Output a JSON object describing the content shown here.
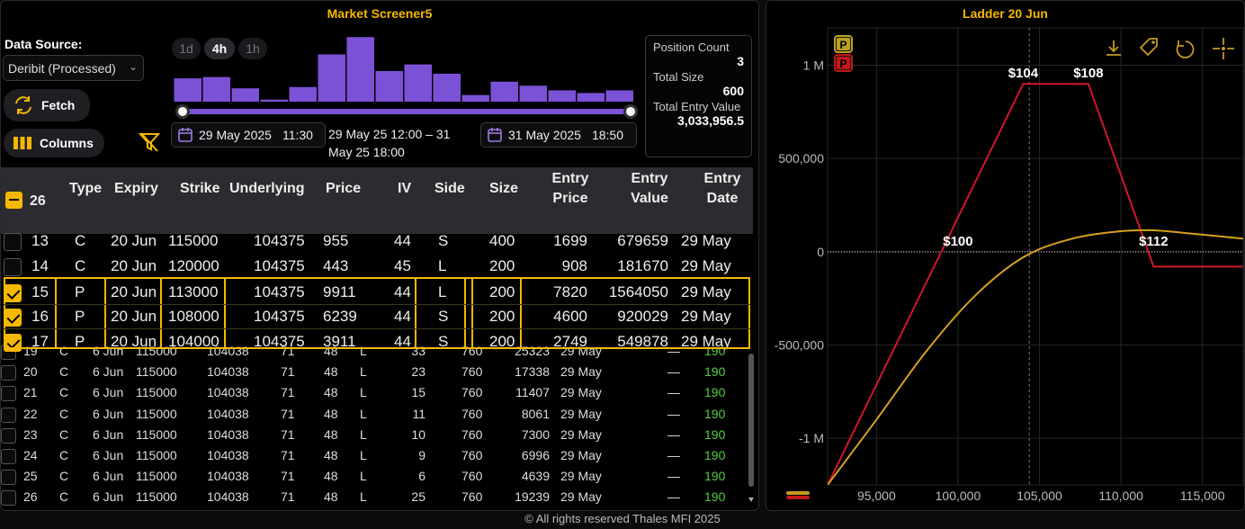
{
  "left_panel": {
    "title": "Market Screener5",
    "data_source_label": "Data Source:",
    "data_source_value": "Deribit (Processed)",
    "fetch_label": "Fetch",
    "columns_label": "Columns",
    "timeframes": [
      "1d",
      "4h",
      "1h"
    ],
    "selected_timeframe": "4h",
    "histogram_values": [
      0.35,
      0.37,
      0.2,
      0.03,
      0.22,
      0.71,
      0.97,
      0.46,
      0.56,
      0.42,
      0.1,
      0.3,
      0.24,
      0.17,
      0.13,
      0.17
    ],
    "histogram_color": "#7b52d6",
    "start_date": "29 May 2025",
    "start_time": "11:30",
    "end_date": "31 May 2025",
    "end_time": "18:50",
    "range_text": "29 May 25 12:00 – 31 May 25 18:00"
  },
  "stats": {
    "position_count_label": "Position Count",
    "position_count": "3",
    "total_size_label": "Total Size",
    "total_size": "600",
    "total_entry_value_label": "Total Entry Value",
    "total_entry_value": "3,033,956.5"
  },
  "table": {
    "header_count": "26",
    "columns": [
      "Type",
      "Expiry",
      "Strike",
      "Underlying",
      "Price",
      "IV",
      "Side",
      "Size",
      "Entry Price",
      "Entry Value",
      "Entry Date"
    ],
    "main_rows": [
      {
        "id": "13",
        "type": "C",
        "expiry": "20 Jun",
        "strike": "115000",
        "underlying": "104375",
        "price": "955",
        "iv": "44",
        "side": "S",
        "size": "400",
        "entry_price": "1699",
        "entry_value": "679659",
        "entry_date": "29 May",
        "checked": false
      },
      {
        "id": "14",
        "type": "C",
        "expiry": "20 Jun",
        "strike": "120000",
        "underlying": "104375",
        "price": "443",
        "iv": "45",
        "side": "L",
        "size": "200",
        "entry_price": "908",
        "entry_value": "181670",
        "entry_date": "29 May",
        "checked": false
      },
      {
        "id": "15",
        "type": "P",
        "expiry": "20 Jun",
        "strike": "113000",
        "underlying": "104375",
        "price": "9911",
        "iv": "44",
        "side": "L",
        "size": "200",
        "entry_price": "7820",
        "entry_value": "1564050",
        "entry_date": "29 May",
        "checked": true
      },
      {
        "id": "16",
        "type": "P",
        "expiry": "20 Jun",
        "strike": "108000",
        "underlying": "104375",
        "price": "6239",
        "iv": "44",
        "side": "S",
        "size": "200",
        "entry_price": "4600",
        "entry_value": "920029",
        "entry_date": "29 May",
        "checked": true
      },
      {
        "id": "17",
        "type": "P",
        "expiry": "20 Jun",
        "strike": "104000",
        "underlying": "104375",
        "price": "3911",
        "iv": "44",
        "side": "S",
        "size": "200",
        "entry_price": "2749",
        "entry_value": "549878",
        "entry_date": "29 May",
        "checked": true
      }
    ],
    "back_rows": [
      {
        "id": "19",
        "type": "C",
        "expiry": "6 Jun",
        "strike": "115000",
        "underlying": "104038",
        "price": "71",
        "iv": "48",
        "side": "L",
        "size": "33",
        "entry_price": "760",
        "entry_value": "25323",
        "entry_date": "29 May",
        "extra": "—",
        "extra2": "190"
      },
      {
        "id": "20",
        "type": "C",
        "expiry": "6 Jun",
        "strike": "115000",
        "underlying": "104038",
        "price": "71",
        "iv": "48",
        "side": "L",
        "size": "23",
        "entry_price": "760",
        "entry_value": "17338",
        "entry_date": "29 May",
        "extra": "—",
        "extra2": "190"
      },
      {
        "id": "21",
        "type": "C",
        "expiry": "6 Jun",
        "strike": "115000",
        "underlying": "104038",
        "price": "71",
        "iv": "48",
        "side": "L",
        "size": "15",
        "entry_price": "760",
        "entry_value": "11407",
        "entry_date": "29 May",
        "extra": "—",
        "extra2": "190"
      },
      {
        "id": "22",
        "type": "C",
        "expiry": "6 Jun",
        "strike": "115000",
        "underlying": "104038",
        "price": "71",
        "iv": "48",
        "side": "L",
        "size": "11",
        "entry_price": "760",
        "entry_value": "8061",
        "entry_date": "29 May",
        "extra": "—",
        "extra2": "190"
      },
      {
        "id": "23",
        "type": "C",
        "expiry": "6 Jun",
        "strike": "115000",
        "underlying": "104038",
        "price": "71",
        "iv": "48",
        "side": "L",
        "size": "10",
        "entry_price": "760",
        "entry_value": "7300",
        "entry_date": "29 May",
        "extra": "—",
        "extra2": "190"
      },
      {
        "id": "24",
        "type": "C",
        "expiry": "6 Jun",
        "strike": "115000",
        "underlying": "104038",
        "price": "71",
        "iv": "48",
        "side": "L",
        "size": "9",
        "entry_price": "760",
        "entry_value": "6996",
        "entry_date": "29 May",
        "extra": "—",
        "extra2": "190"
      },
      {
        "id": "25",
        "type": "C",
        "expiry": "6 Jun",
        "strike": "115000",
        "underlying": "104038",
        "price": "71",
        "iv": "48",
        "side": "L",
        "size": "6",
        "entry_price": "760",
        "entry_value": "4639",
        "entry_date": "29 May",
        "extra": "—",
        "extra2": "190"
      },
      {
        "id": "26",
        "type": "C",
        "expiry": "6 Jun",
        "strike": "115000",
        "underlying": "104038",
        "price": "71",
        "iv": "48",
        "side": "L",
        "size": "25",
        "entry_price": "760",
        "entry_value": "19239",
        "entry_date": "29 May",
        "extra": "—",
        "extra2": "190"
      }
    ],
    "accent_color": "#f5b800",
    "green_color": "#55cc44"
  },
  "right_panel": {
    "title": "Ladder 20 Jun",
    "legend_badges": [
      "P",
      "P"
    ]
  },
  "chart_data": {
    "type": "line",
    "title": "Ladder 20 Jun",
    "xlabel": "",
    "ylabel": "",
    "xlim": [
      92000,
      117500
    ],
    "ylim": [
      -1250000,
      1200000
    ],
    "x_ticks": [
      95000,
      100000,
      105000,
      110000,
      115000
    ],
    "x_tick_labels": [
      "95,000",
      "100,000",
      "105,000",
      "110,000",
      "115,000"
    ],
    "y_ticks": [
      1000000,
      500000,
      0,
      -500000,
      -1000000
    ],
    "y_tick_labels": [
      "1 M",
      "500,000",
      "0",
      "-500,000",
      "-1 M"
    ],
    "grid": true,
    "current_price": 104375,
    "series": [
      {
        "color": "#d0162a",
        "points": [
          [
            92000,
            -1250000
          ],
          [
            104000,
            900000
          ],
          [
            108000,
            900000
          ],
          [
            112000,
            -80000
          ],
          [
            117500,
            -80000
          ]
        ]
      },
      {
        "color": "#d4a020",
        "points": [
          [
            92000,
            -1250000
          ],
          [
            95000,
            -900000
          ],
          [
            98000,
            -540000
          ],
          [
            101000,
            -240000
          ],
          [
            104000,
            -30000
          ],
          [
            107000,
            70000
          ],
          [
            110000,
            110000
          ],
          [
            112000,
            115000
          ],
          [
            114000,
            100000
          ],
          [
            117500,
            70000
          ]
        ]
      }
    ],
    "annotations": [
      {
        "label": "$104",
        "x": 104000,
        "y": 900000
      },
      {
        "label": "$108",
        "x": 108000,
        "y": 900000
      },
      {
        "label": "$100",
        "x": 100000,
        "y": 0
      },
      {
        "label": "$112",
        "x": 112000,
        "y": 0
      }
    ]
  },
  "footer": {
    "text": "© All rights reserved Thales MFI 2025"
  }
}
